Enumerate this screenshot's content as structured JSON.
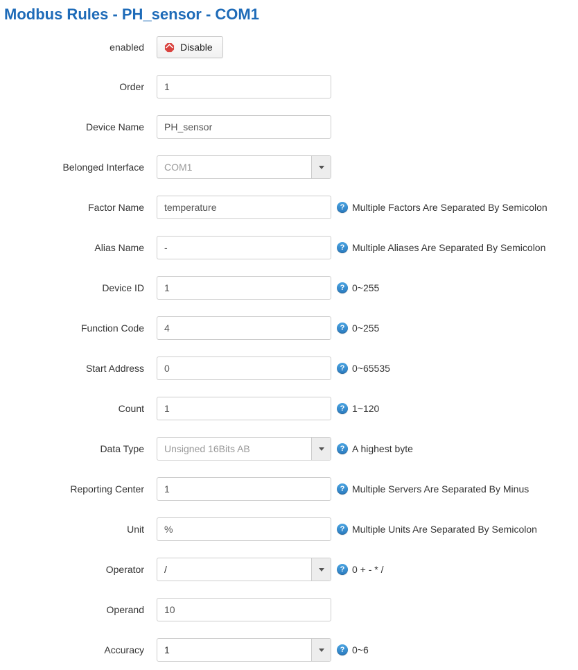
{
  "title": "Modbus Rules - PH_sensor - COM1",
  "fields": {
    "enabled": {
      "label": "enabled",
      "button_label": "Disable"
    },
    "order": {
      "label": "Order",
      "value": "1"
    },
    "device_name": {
      "label": "Device Name",
      "value": "PH_sensor"
    },
    "interface": {
      "label": "Belonged Interface",
      "value": "COM1"
    },
    "factor_name": {
      "label": "Factor Name",
      "value": "temperature",
      "hint": "Multiple Factors Are Separated By Semicolon"
    },
    "alias_name": {
      "label": "Alias Name",
      "value": "-",
      "hint": "Multiple Aliases Are Separated By Semicolon"
    },
    "device_id": {
      "label": "Device ID",
      "value": "1",
      "hint": "0~255"
    },
    "function_code": {
      "label": "Function Code",
      "value": "4",
      "hint": "0~255"
    },
    "start_address": {
      "label": "Start Address",
      "value": "0",
      "hint": "0~65535"
    },
    "count": {
      "label": "Count",
      "value": "1",
      "hint": "1~120"
    },
    "data_type": {
      "label": "Data Type",
      "value": "Unsigned 16Bits AB",
      "hint": "A highest byte"
    },
    "reporting_center": {
      "label": "Reporting Center",
      "value": "1",
      "hint": "Multiple Servers Are Separated By Minus"
    },
    "unit": {
      "label": "Unit",
      "value": "%",
      "hint": "Multiple Units Are Separated By Semicolon"
    },
    "operator": {
      "label": "Operator",
      "value": "/",
      "hint": "0 + - * /"
    },
    "operand": {
      "label": "Operand",
      "value": "10"
    },
    "accuracy": {
      "label": "Accuracy",
      "value": "1",
      "hint": "0~6"
    }
  }
}
